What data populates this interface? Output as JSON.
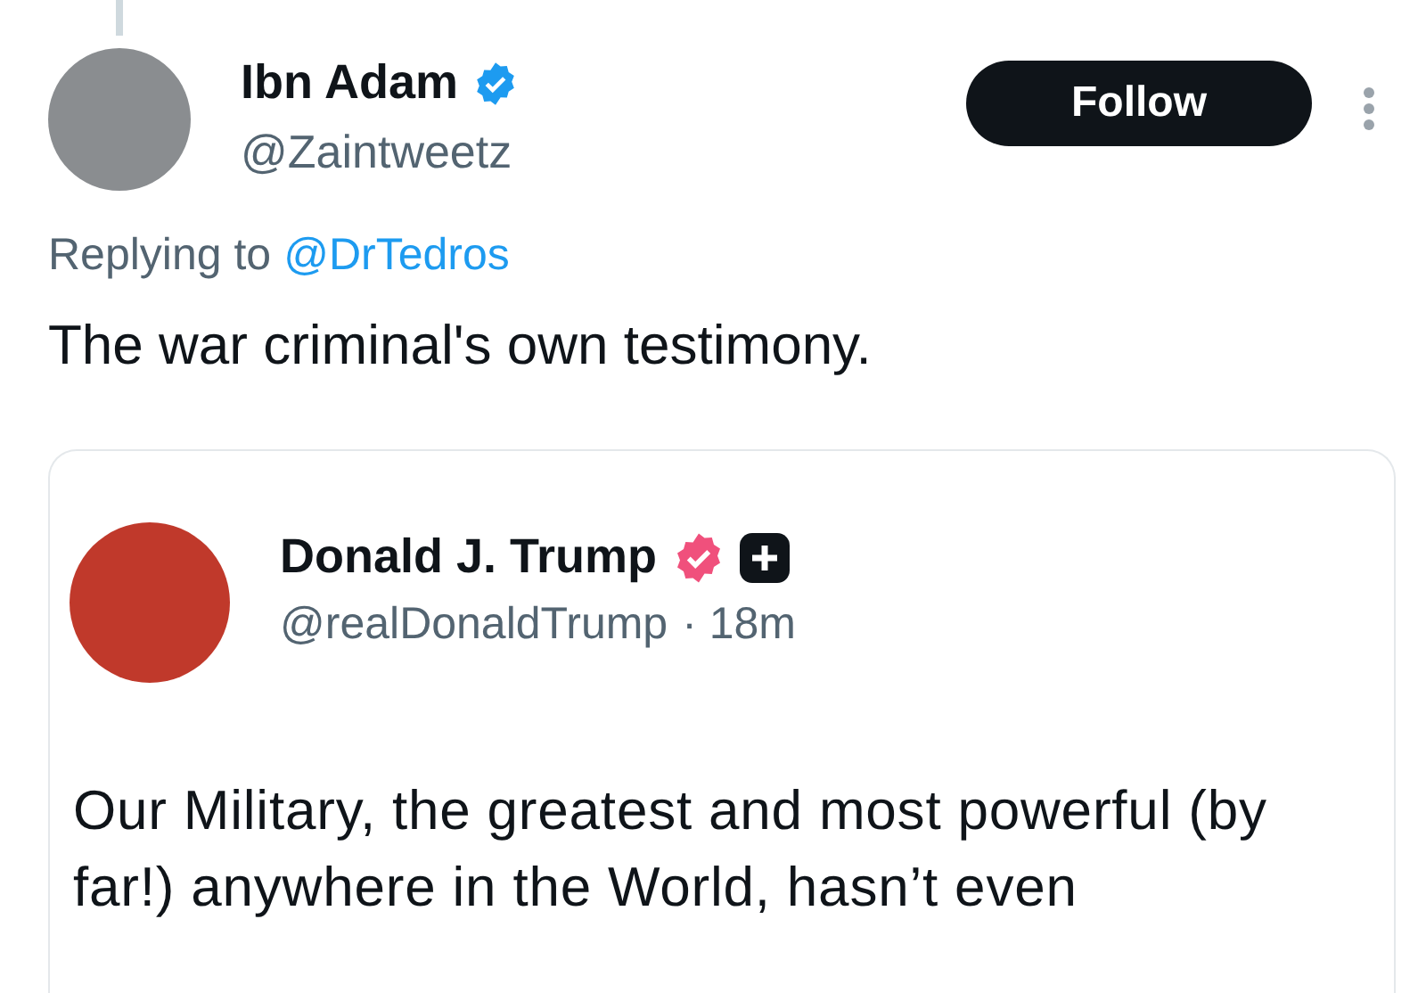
{
  "tweet": {
    "author": {
      "name": "Ibn Adam",
      "handle": "@Zaintweetz",
      "verified": true
    },
    "follow_button": "Follow",
    "replying_to": {
      "label": "Replying to",
      "handle": "@DrTedros"
    },
    "text": "The war criminal's own testimony.",
    "quoted_post": {
      "author": {
        "name": "Donald J. Trump",
        "handle": "@realDonaldTrump",
        "verified": true,
        "affiliate_badge": true
      },
      "time": "· 18m",
      "text": "Our Military, the greatest and most powerful (by far!) anywhere in the World, hasn’t even"
    }
  }
}
